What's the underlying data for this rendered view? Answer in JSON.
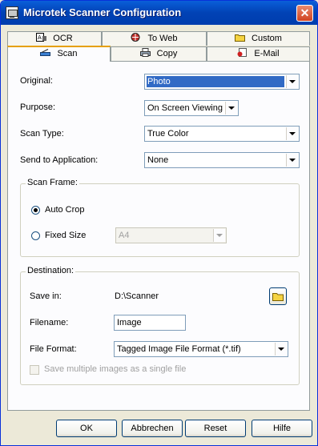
{
  "window": {
    "title": "Microtek Scanner Configuration"
  },
  "tabs": {
    "top": [
      {
        "label": "OCR",
        "icon": "ocr-icon"
      },
      {
        "label": "To Web",
        "icon": "globe-icon"
      },
      {
        "label": "Custom",
        "icon": "folder-icon"
      }
    ],
    "bottom": [
      {
        "label": "Scan",
        "icon": "scanner-icon",
        "active": true
      },
      {
        "label": "Copy",
        "icon": "printer-icon"
      },
      {
        "label": "E-Mail",
        "icon": "email-icon"
      }
    ]
  },
  "form": {
    "original": {
      "label": "Original:",
      "value": "Photo"
    },
    "purpose": {
      "label": "Purpose:",
      "value": "On Screen Viewing"
    },
    "scan_type": {
      "label": "Scan Type:",
      "value": "True Color"
    },
    "send_to": {
      "label": "Send to Application:",
      "value": "None"
    }
  },
  "scan_frame": {
    "title": "Scan Frame:",
    "auto_crop": {
      "label": "Auto Crop",
      "checked": true
    },
    "fixed_size": {
      "label": "Fixed Size",
      "checked": false,
      "value": "A4"
    }
  },
  "destination": {
    "title": "Destination:",
    "save_in": {
      "label": "Save in:",
      "value": "D:\\Scanner"
    },
    "filename": {
      "label": "Filename:",
      "value": "Image"
    },
    "file_format": {
      "label": "File Format:",
      "value": "Tagged Image File Format (*.tif)"
    },
    "multi": {
      "label": "Save multiple images as a single file",
      "checked": false
    }
  },
  "buttons": {
    "ok": "OK",
    "cancel": "Abbrechen",
    "reset": "Reset",
    "help": "Hilfe"
  },
  "colors": {
    "accent": "#0054e3",
    "selection": "#316ac5",
    "close": "#d1431f"
  }
}
